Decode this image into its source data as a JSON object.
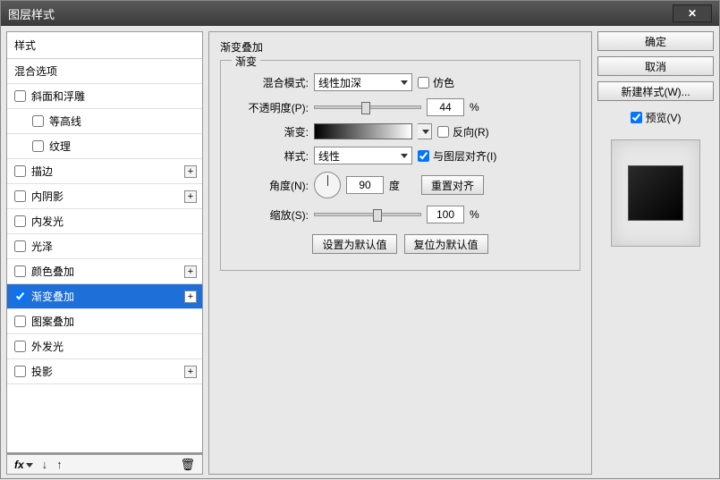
{
  "window": {
    "title": "图层样式"
  },
  "left": {
    "header": "样式",
    "blendingOptions": "混合选项",
    "items": [
      {
        "label": "斜面和浮雕",
        "checked": false,
        "hasPlus": false,
        "indent": false
      },
      {
        "label": "等高线",
        "checked": false,
        "hasPlus": false,
        "indent": true
      },
      {
        "label": "纹理",
        "checked": false,
        "hasPlus": false,
        "indent": true
      },
      {
        "label": "描边",
        "checked": false,
        "hasPlus": true,
        "indent": false
      },
      {
        "label": "内阴影",
        "checked": false,
        "hasPlus": true,
        "indent": false
      },
      {
        "label": "内发光",
        "checked": false,
        "hasPlus": false,
        "indent": false
      },
      {
        "label": "光泽",
        "checked": false,
        "hasPlus": false,
        "indent": false
      },
      {
        "label": "颜色叠加",
        "checked": false,
        "hasPlus": true,
        "indent": false
      },
      {
        "label": "渐变叠加",
        "checked": true,
        "hasPlus": true,
        "indent": false,
        "selected": true
      },
      {
        "label": "图案叠加",
        "checked": false,
        "hasPlus": false,
        "indent": false
      },
      {
        "label": "外发光",
        "checked": false,
        "hasPlus": false,
        "indent": false
      },
      {
        "label": "投影",
        "checked": false,
        "hasPlus": true,
        "indent": false
      }
    ],
    "fxLabel": "fx"
  },
  "main": {
    "sectionTitle": "渐变叠加",
    "fieldsetTitle": "渐变",
    "blendMode": {
      "label": "混合模式:",
      "value": "线性加深"
    },
    "dither": {
      "label": "仿色",
      "checked": false
    },
    "opacity": {
      "label": "不透明度(P):",
      "value": "44",
      "unit": "%",
      "sliderPct": 44
    },
    "gradient": {
      "label": "渐变:"
    },
    "reverse": {
      "label": "反向(R)",
      "checked": false
    },
    "style": {
      "label": "样式:",
      "value": "线性"
    },
    "alignWithLayer": {
      "label": "与图层对齐(I)",
      "checked": true
    },
    "angle": {
      "label": "角度(N):",
      "value": "90",
      "unit": "度"
    },
    "resetAlign": "重置对齐",
    "scale": {
      "label": "缩放(S):",
      "value": "100",
      "unit": "%",
      "sliderPct": 50
    },
    "makeDefault": "设置为默认值",
    "resetDefault": "复位为默认值"
  },
  "right": {
    "ok": "确定",
    "cancel": "取消",
    "newStyle": "新建样式(W)...",
    "preview": "预览(V)",
    "previewChecked": true
  }
}
